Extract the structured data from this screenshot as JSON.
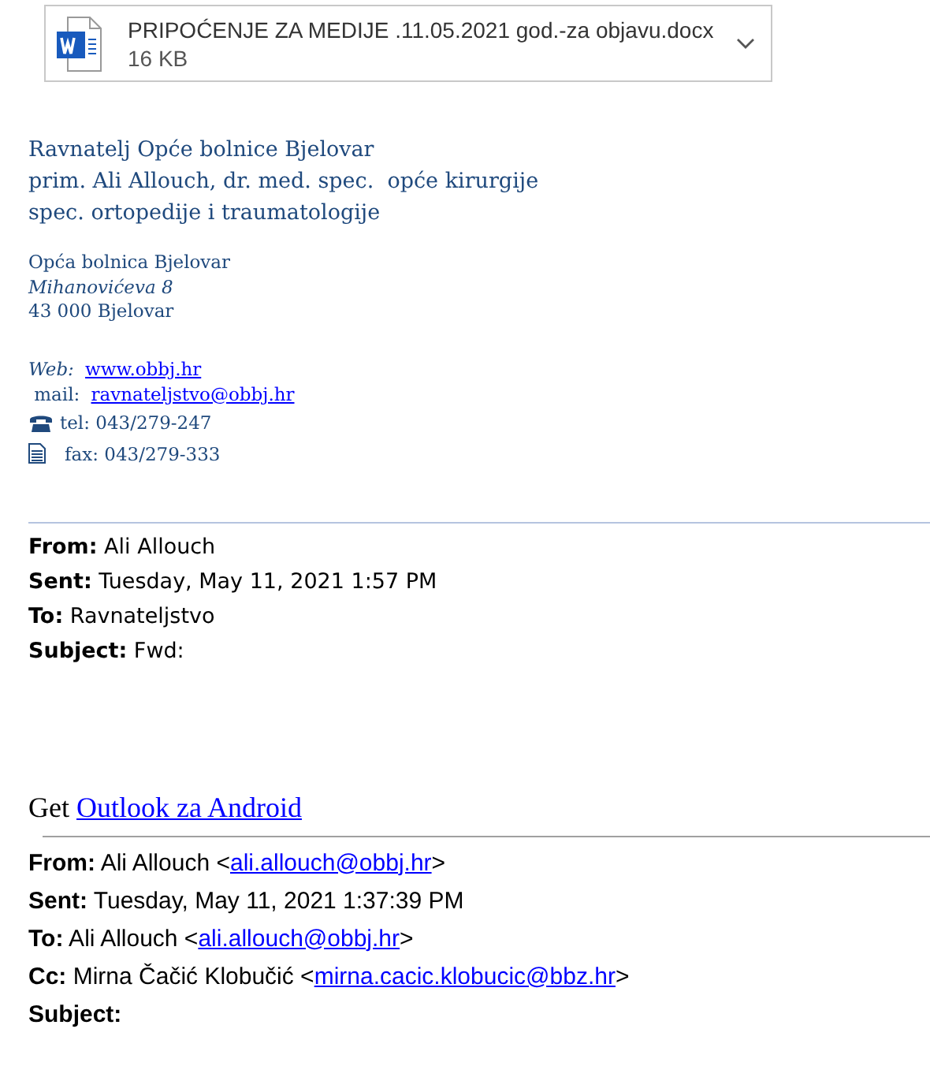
{
  "attachment": {
    "name": "PRIPOĆENJE ZA MEDIJE .11.05.2021 god.-za objavu.docx",
    "size": "16 KB"
  },
  "signature": {
    "title_lines": [
      "Ravnatelj Opće bolnice Bjelovar",
      "prim. Ali Allouch, dr. med. spec.  opće kirurgije",
      "spec. ortopedije i traumatologije"
    ],
    "address": [
      {
        "text": "Opća bolnica Bjelovar",
        "italic": false
      },
      {
        "text": "Mihanovićeva 8",
        "italic": true
      },
      {
        "text": "43 000 Bjelovar",
        "italic": false
      }
    ],
    "contacts": [
      {
        "kind": "link",
        "label": "*Web:* ",
        "link": "www.obbj.hr"
      },
      {
        "kind": "link",
        "label": " mail: ",
        "link": "ravnateljstvo@obbj.hr"
      },
      {
        "kind": "phone",
        "label": "tel: 043/279-247"
      },
      {
        "kind": "fax",
        "label": "fax: 043/279-333"
      }
    ]
  },
  "forward_header": [
    {
      "label": "From:",
      "value": "Ali Allouch"
    },
    {
      "label": "Sent:",
      "value": "Tuesday, May 11, 2021 1:57 PM"
    },
    {
      "label": "To:",
      "value": "Ravnateljstvo"
    },
    {
      "label": "Subject:",
      "value": "Fwd:"
    }
  ],
  "promo": {
    "text": "Get ",
    "link": "Outlook za Android"
  },
  "original_header": [
    {
      "label": "From:",
      "value": "Ali Allouch <",
      "link": "ali.allouch@obbj.hr",
      "suffix": ">"
    },
    {
      "label": "Sent:",
      "value": "Tuesday, May 11, 2021 1:37:39 PM"
    },
    {
      "label": "To:",
      "value": "Ali Allouch <",
      "link": "ali.allouch@obbj.hr",
      "suffix": ">"
    },
    {
      "label": "Cc:",
      "value": "Mirna Čačić Klobučić <",
      "link": "mirna.cacic.klobucic@bbz.hr",
      "suffix": ">"
    },
    {
      "label": "Subject:"
    }
  ]
}
